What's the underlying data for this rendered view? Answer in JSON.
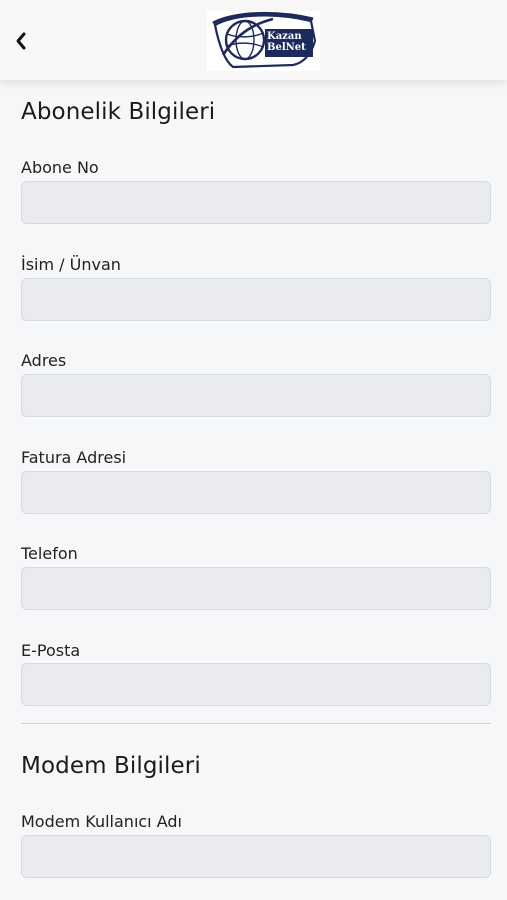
{
  "header": {
    "back_icon": "chevron-left-icon",
    "logo": {
      "line1": "Kazan",
      "line2": "BelNet",
      "brand_color": "#1d2a5c"
    }
  },
  "subscription": {
    "title": "Abonelik Bilgileri",
    "fields": [
      {
        "label": "Abone No",
        "value": "",
        "placeholder": ""
      },
      {
        "label": "İsim / Ünvan",
        "value": "",
        "placeholder": ""
      },
      {
        "label": "Adres",
        "value": "",
        "placeholder": ""
      },
      {
        "label": "Fatura Adresi",
        "value": "",
        "placeholder": ""
      },
      {
        "label": "Telefon",
        "value": "",
        "placeholder": ""
      },
      {
        "label": "E-Posta",
        "value": "",
        "placeholder": ""
      }
    ]
  },
  "modem": {
    "title": "Modem Bilgileri",
    "fields": [
      {
        "label": "Modem Kullanıcı Adı",
        "value": "",
        "placeholder": ""
      }
    ]
  },
  "colors": {
    "background": "#f6f7f9",
    "input_background": "#e9ebee",
    "input_border": "#d6d9dd",
    "text": "#1f1f1f"
  }
}
